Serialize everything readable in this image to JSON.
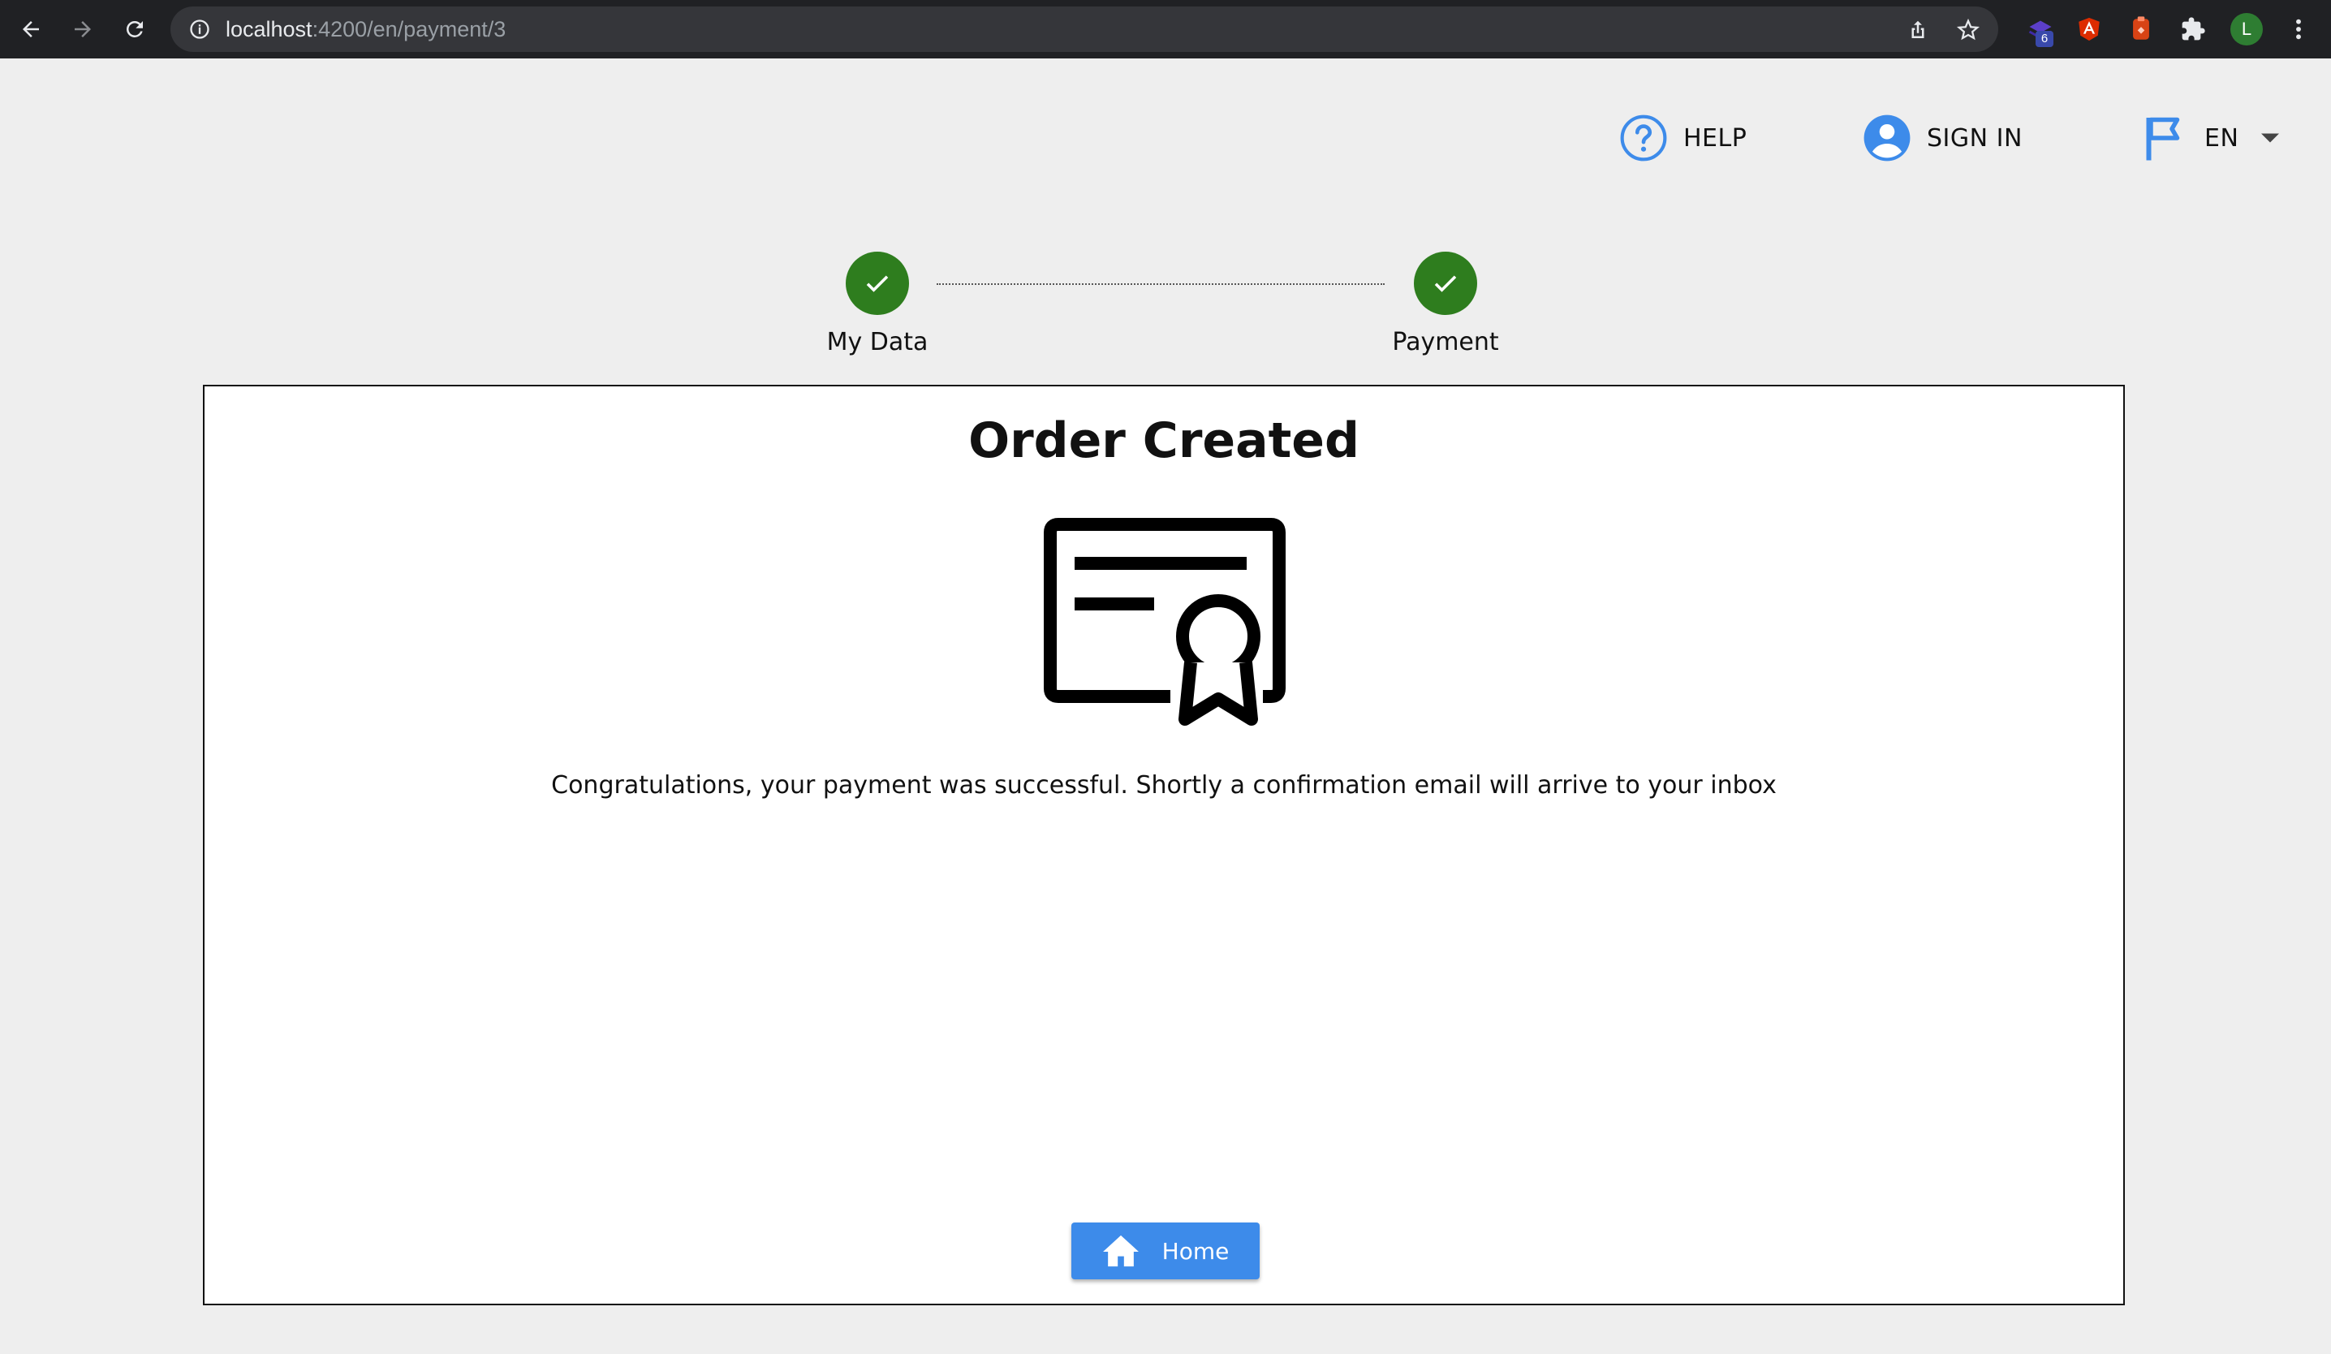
{
  "browser": {
    "url_host": "localhost",
    "url_path": ":4200/en/payment/3",
    "extension_badge": "6",
    "profile_initial": "L"
  },
  "header": {
    "help_label": "HELP",
    "sign_in_label": "SIGN IN",
    "language_label": "EN"
  },
  "stepper": {
    "steps": [
      {
        "label": "My Data",
        "status": "completed"
      },
      {
        "label": "Payment",
        "status": "completed"
      }
    ]
  },
  "main": {
    "title": "Order Created",
    "icon": "certificate-icon",
    "message": "Congratulations, your payment was successful. Shortly a confirmation email will arrive to your inbox",
    "home_button_label": "Home"
  },
  "colors": {
    "accent": "#3d8bea",
    "step_complete": "#2e7d1e",
    "page_background": "#eeeeee"
  }
}
